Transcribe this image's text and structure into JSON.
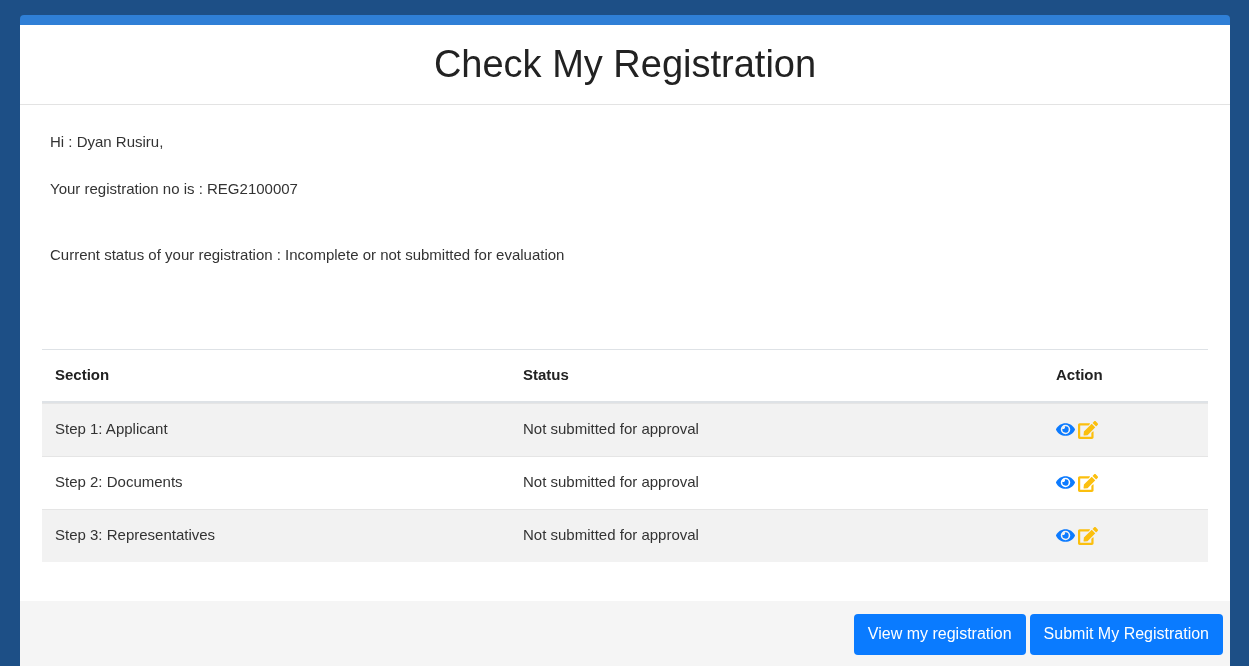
{
  "modal": {
    "title": "Check My Registration",
    "greeting": "Hi : Dyan Rusiru,",
    "registration_line": "Your registration no is : REG2100007",
    "status_line": "Current status of your registration : Incomplete or not submitted for evaluation",
    "table": {
      "columns": [
        "Section",
        "Status",
        "Action"
      ],
      "rows": [
        {
          "section": "Step 1: Applicant",
          "status": "Not submitted for approval"
        },
        {
          "section": "Step 2: Documents",
          "status": "Not submitted for approval"
        },
        {
          "section": "Step 3: Representatives",
          "status": "Not submitted for approval"
        }
      ]
    },
    "buttons": [
      "View my registration",
      "Submit My Registration"
    ]
  }
}
